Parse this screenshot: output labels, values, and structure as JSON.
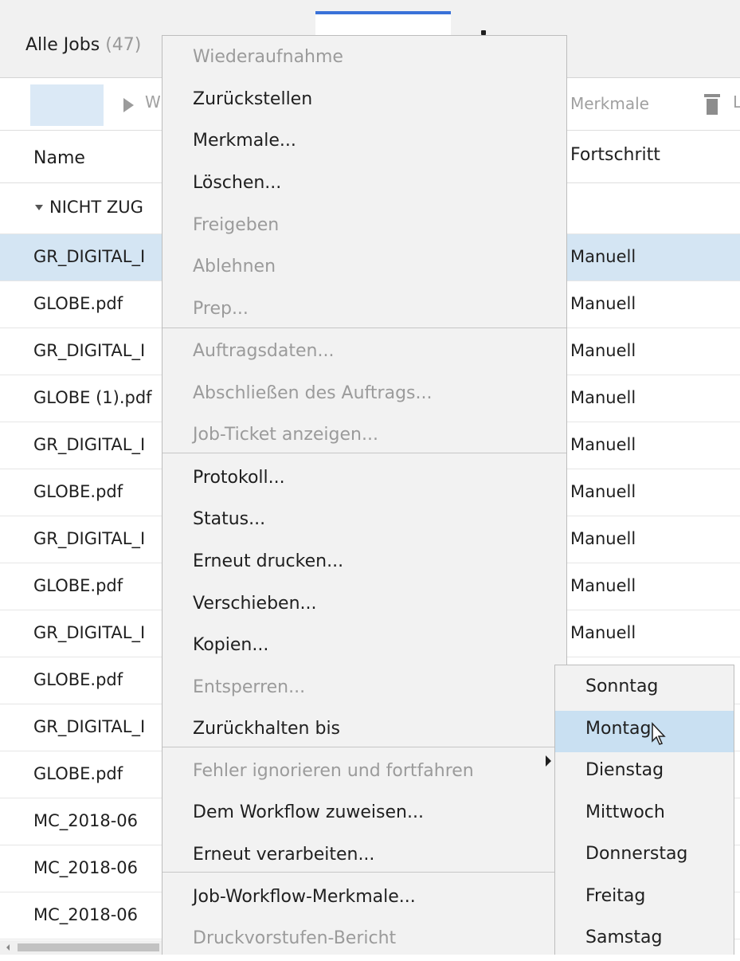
{
  "tabs": {
    "all_jobs_label": "Alle Jobs",
    "all_jobs_count": "(47)"
  },
  "toolbar": {
    "play_label": "W",
    "merkmale_label": "Merkmale",
    "trash_icon": "trash-icon",
    "delete_label": "L"
  },
  "columns": {
    "name": "Name",
    "progress": "Fortschritt"
  },
  "group": {
    "label": "NICHT ZUG"
  },
  "rows": [
    {
      "name": "GR_DIGITAL_I",
      "progress": "Manuell",
      "selected": true
    },
    {
      "name": "GLOBE.pdf",
      "progress": "Manuell"
    },
    {
      "name": "GR_DIGITAL_I",
      "progress": "Manuell"
    },
    {
      "name": "GLOBE (1).pdf",
      "progress": "Manuell"
    },
    {
      "name": "GR_DIGITAL_I",
      "progress": "Manuell"
    },
    {
      "name": "GLOBE.pdf",
      "progress": "Manuell"
    },
    {
      "name": "GR_DIGITAL_I",
      "progress": "Manuell"
    },
    {
      "name": "GLOBE.pdf",
      "progress": "Manuell"
    },
    {
      "name": "GR_DIGITAL_I",
      "progress": "Manuell"
    },
    {
      "name": "GLOBE.pdf",
      "progress": ""
    },
    {
      "name": "GR_DIGITAL_I",
      "progress": ""
    },
    {
      "name": "GLOBE.pdf",
      "progress": ""
    },
    {
      "name": "MC_2018-06",
      "progress": ""
    },
    {
      "name": "MC_2018-06",
      "progress": ""
    },
    {
      "name": "MC_2018-06",
      "progress": ""
    }
  ],
  "context_menu": {
    "items": [
      {
        "label": "Wiederaufnahme",
        "enabled": false
      },
      {
        "label": "Zurückstellen",
        "enabled": true
      },
      {
        "label": "Merkmale...",
        "enabled": true
      },
      {
        "label": "Löschen...",
        "enabled": true
      },
      {
        "label": "Freigeben",
        "enabled": false
      },
      {
        "label": "Ablehnen",
        "enabled": false
      },
      {
        "label": "Prep...",
        "enabled": false
      },
      {
        "label": "Auftragsdaten...",
        "enabled": false
      },
      {
        "label": "Abschließen des Auftrags...",
        "enabled": false
      },
      {
        "label": "Job-Ticket anzeigen...",
        "enabled": false
      },
      {
        "label": "Protokoll...",
        "enabled": true
      },
      {
        "label": "Status...",
        "enabled": true
      },
      {
        "label": "Erneut drucken...",
        "enabled": true
      },
      {
        "label": "Verschieben...",
        "enabled": true
      },
      {
        "label": "Kopien...",
        "enabled": true
      },
      {
        "label": "Entsperren...",
        "enabled": false
      },
      {
        "label": "Zurückhalten bis",
        "enabled": true,
        "submenu": true
      },
      {
        "label": "Fehler ignorieren und fortfahren",
        "enabled": false
      },
      {
        "label": "Dem Workflow zuweisen...",
        "enabled": true
      },
      {
        "label": "Erneut verarbeiten...",
        "enabled": true
      },
      {
        "label": "Job-Workflow-Merkmale...",
        "enabled": true
      },
      {
        "label": "Druckvorstufen-Bericht",
        "enabled": false
      }
    ]
  },
  "submenu": {
    "items": [
      {
        "label": "Sonntag"
      },
      {
        "label": "Montag",
        "highlighted": true
      },
      {
        "label": "Dienstag"
      },
      {
        "label": "Mittwoch"
      },
      {
        "label": "Donnerstag"
      },
      {
        "label": "Freitag"
      },
      {
        "label": "Samstag"
      }
    ]
  },
  "colors": {
    "accent": "#3a72d8",
    "selection": "#d4e5f3",
    "hover": "#c9e0f2"
  }
}
